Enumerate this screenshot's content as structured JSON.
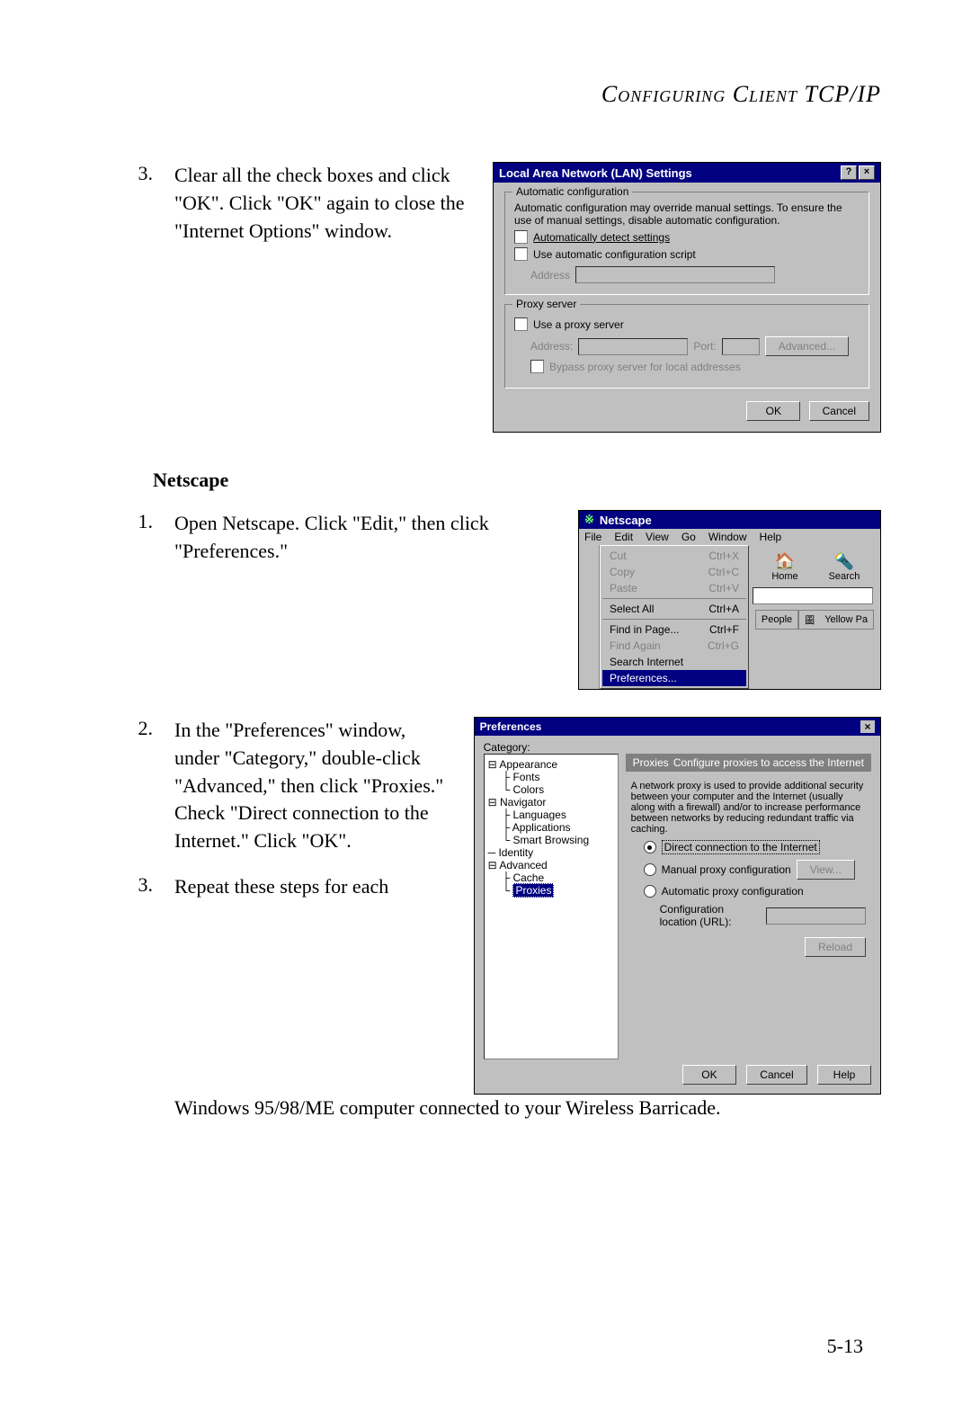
{
  "header": "Configuring Client TCP/IP",
  "page_number": "5-13",
  "top_step": {
    "num": "3.",
    "text": "Clear all the check boxes and click \"OK\". Click \"OK\" again to close the \"Internet Options\" window."
  },
  "lan_dialog": {
    "title": "Local Area Network (LAN) Settings",
    "help_btn": "?",
    "close_btn": "×",
    "auto_legend": "Automatic configuration",
    "auto_desc": "Automatic configuration may override manual settings.  To ensure the use of manual settings, disable automatic configuration.",
    "cb_detect": "Automatically detect settings",
    "cb_script": "Use automatic configuration script",
    "addr_label": "Address",
    "proxy_legend": "Proxy server",
    "cb_proxy": "Use a proxy server",
    "proxy_addr": "Address:",
    "proxy_port": "Port:",
    "advanced_btn": "Advanced...",
    "cb_bypass": "Bypass proxy server for local addresses",
    "ok": "OK",
    "cancel": "Cancel"
  },
  "netscape_heading": "Netscape",
  "ns_step1": {
    "num": "1.",
    "text": "Open Netscape. Click \"Edit,\" then click \"Preferences.\""
  },
  "ns_menu": {
    "title": "Netscape",
    "menubar": [
      "File",
      "Edit",
      "View",
      "Go",
      "Window",
      "Help"
    ],
    "menu": [
      {
        "label": "Cut",
        "sc": "Ctrl+X",
        "dis": true
      },
      {
        "label": "Copy",
        "sc": "Ctrl+C",
        "dis": true
      },
      {
        "label": "Paste",
        "sc": "Ctrl+V",
        "dis": true
      },
      {
        "sep": true
      },
      {
        "label": "Select All",
        "sc": "Ctrl+A"
      },
      {
        "sep": true
      },
      {
        "label": "Find in Page...",
        "sc": "Ctrl+F"
      },
      {
        "label": "Find Again",
        "sc": "Ctrl+G",
        "dis": true
      },
      {
        "label": "Search Internet",
        "sc": ""
      },
      {
        "label": "Preferences...",
        "sc": "",
        "sel": true
      }
    ],
    "icons": {
      "home": "Home",
      "search": "Search",
      "people": "People",
      "yellow": "Yellow Pa"
    }
  },
  "ns_step2": {
    "num": "2.",
    "text": "In the \"Preferences\" window, under \"Category,\" double-click \"Advanced,\" then click \"Proxies.\" Check \"Direct connection to the Internet.\" Click \"OK\"."
  },
  "ns_step3": {
    "num": "3.",
    "text": "Repeat these steps for each Windows 95/98/ME computer connected to your Wireless Barricade."
  },
  "pref": {
    "title": "Preferences",
    "close": "×",
    "category_label": "Category:",
    "tree": {
      "appearance": "Appearance",
      "fonts": "Fonts",
      "colors": "Colors",
      "navigator": "Navigator",
      "languages": "Languages",
      "applications": "Applications",
      "smart": "Smart Browsing",
      "identity": "Identity",
      "advanced": "Advanced",
      "cache": "Cache",
      "proxies": "Proxies"
    },
    "panel_title": "Proxies",
    "panel_sub": "Configure proxies to access the Internet",
    "desc": "A network proxy is used to provide additional security between your computer and the Internet (usually along with a firewall) and/or to increase performance between networks by reducing redundant traffic via caching.",
    "rb_direct": "Direct connection to the Internet",
    "rb_manual": "Manual proxy configuration",
    "view_btn": "View...",
    "rb_auto": "Automatic proxy configuration",
    "url_label": "Configuration location (URL):",
    "reload": "Reload",
    "ok": "OK",
    "cancel": "Cancel",
    "help": "Help"
  }
}
